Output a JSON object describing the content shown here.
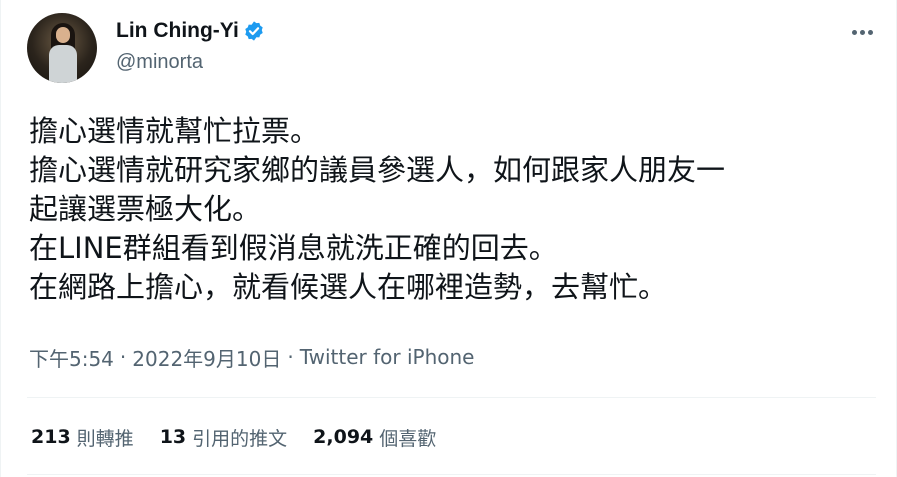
{
  "author": {
    "display_name": "Lin Ching-Yi",
    "handle": "@minorta",
    "avatar_icon": "profile-photo",
    "verified_icon": "verified-badge-icon"
  },
  "menu_icon": "more-options-icon",
  "tweet": {
    "lines": [
      "擔心選情就幫忙拉票。",
      "擔心選情就研究家鄉的議員參選人，如何跟家人朋友一",
      "起讓選票極大化。",
      "在LINE群組看到假消息就洗正確的回去。",
      "在網路上擔心，就看候選人在哪裡造勢，去幫忙。"
    ]
  },
  "meta": {
    "time": "下午5:54",
    "separator": "·",
    "date": "2022年9月10日",
    "source": "Twitter for iPhone"
  },
  "stats": {
    "retweets": {
      "count": "213",
      "label": "則轉推"
    },
    "quotes": {
      "count": "13",
      "label": "引用的推文"
    },
    "likes": {
      "count": "2,094",
      "label": "個喜歡"
    }
  },
  "colors": {
    "text": "#0f1419",
    "secondary": "#536471",
    "verified": "#1d9bf0",
    "divider": "#eff3f4"
  }
}
